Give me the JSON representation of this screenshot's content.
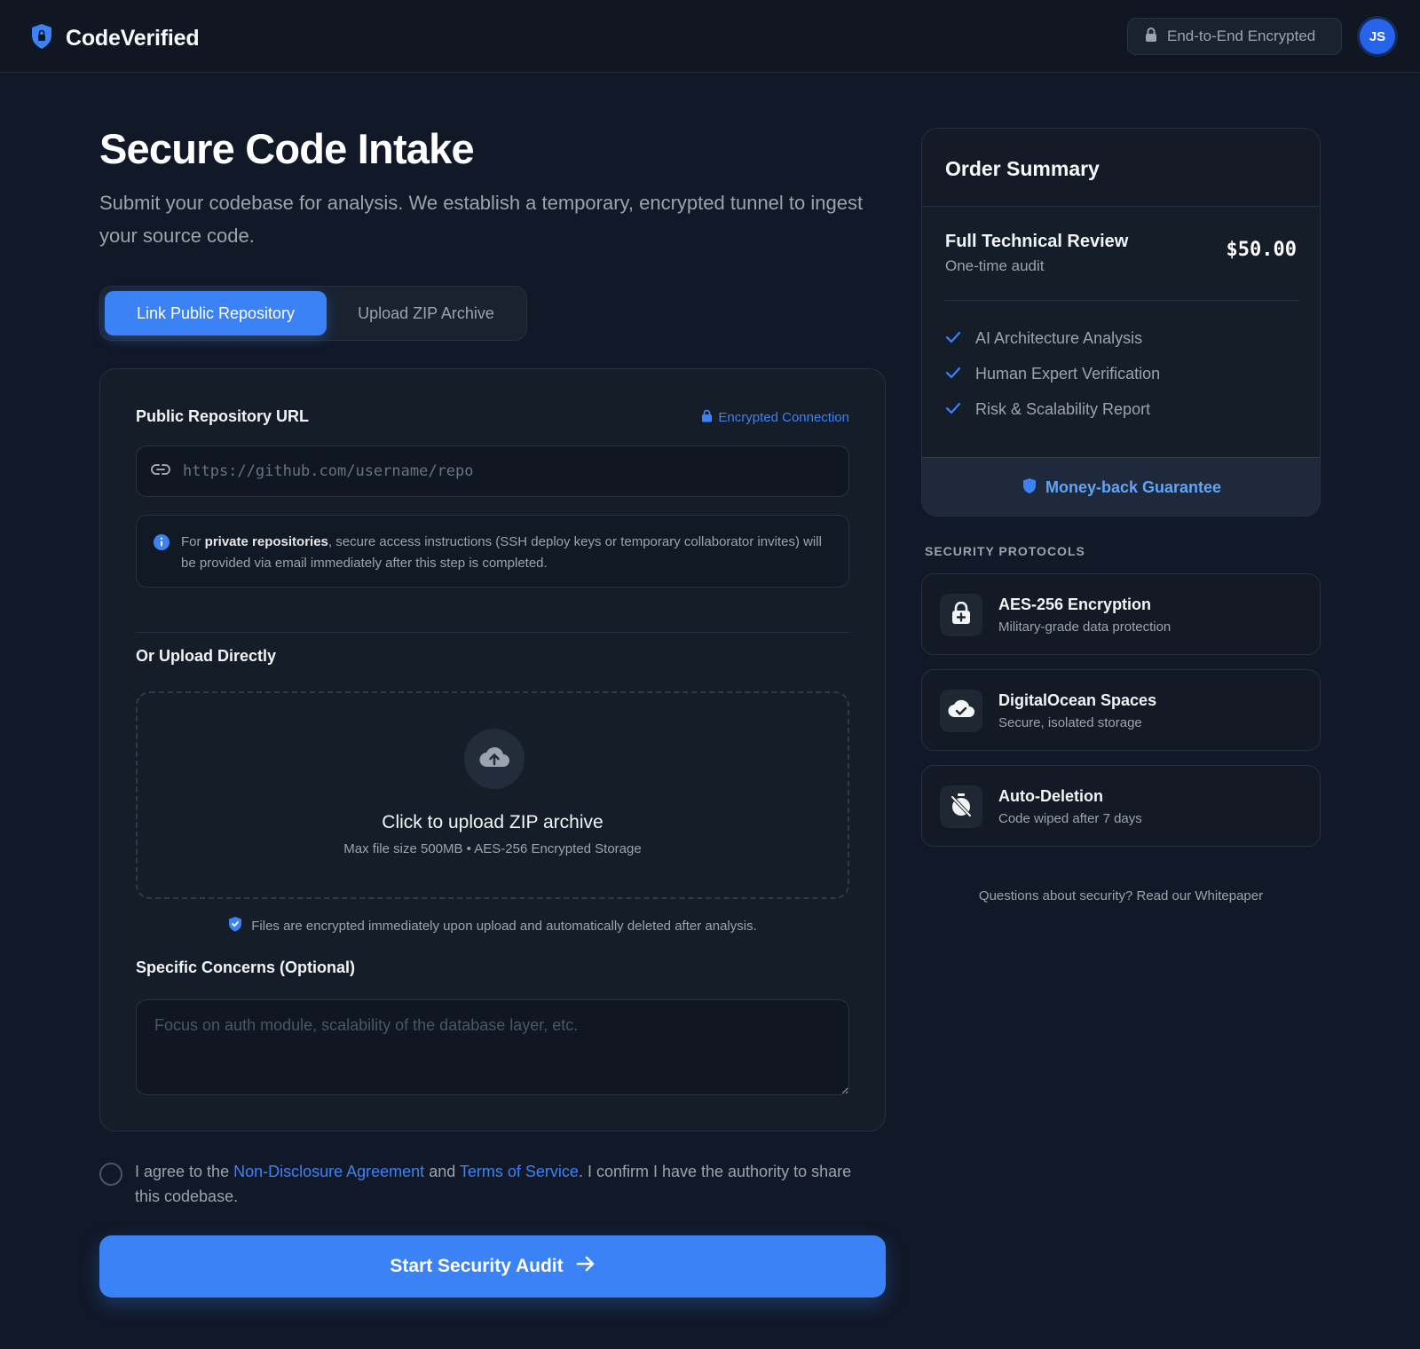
{
  "brand": {
    "name": "CodeVerified",
    "icon": "shield-lock-icon",
    "accent": "#3b82f6"
  },
  "header": {
    "encryption_badge": "End-to-End Encrypted",
    "avatar_initials": "JS"
  },
  "main": {
    "title": "Secure Code Intake",
    "subtitle": "Submit your codebase for analysis. We establish a temporary, encrypted tunnel to ingest your source code.",
    "tabs": [
      {
        "label": "Link Public Repository",
        "active": true
      },
      {
        "label": "Upload ZIP Archive",
        "active": false
      }
    ],
    "repo": {
      "label": "Public Repository URL",
      "encrypted_label": "Encrypted Connection",
      "placeholder": "https://github.com/username/repo",
      "info_prefix": "For ",
      "info_bold": "private repositories",
      "info_rest": ", secure access instructions (SSH deploy keys or temporary collaborator invites) will be provided via email immediately after this step is completed."
    },
    "upload": {
      "label": "Or Upload Directly",
      "title": "Click to upload ZIP archive",
      "subtitle": "Max file size 500MB • AES-256 Encrypted Storage",
      "note": "Files are encrypted immediately upon upload and automatically deleted after analysis."
    },
    "concerns": {
      "label": "Specific Concerns (Optional)",
      "placeholder": "Focus on auth module, scalability of the database layer, etc."
    },
    "agreement": {
      "prefix": "I agree to the ",
      "nda_link": "Non-Disclosure Agreement",
      "middle": " and ",
      "tos_link": "Terms of Service",
      "suffix": ". I confirm I have the authority to share this codebase."
    },
    "cta_label": "Start Security Audit"
  },
  "order": {
    "title": "Order Summary",
    "item_name": "Full Technical Review",
    "item_sub": "One-time audit",
    "price": "$50.00",
    "features": [
      "AI Architecture Analysis",
      "Human Expert Verification",
      "Risk & Scalability Report"
    ],
    "guarantee": "Money-back Guarantee"
  },
  "security": {
    "title": "SECURITY PROTOCOLS",
    "protocols": [
      {
        "title": "AES-256 Encryption",
        "subtitle": "Military-grade data protection",
        "icon": "lock-plus-icon"
      },
      {
        "title": "DigitalOcean Spaces",
        "subtitle": "Secure, isolated storage",
        "icon": "cloud-check-icon"
      },
      {
        "title": "Auto-Deletion",
        "subtitle": "Code wiped after 7 days",
        "icon": "timer-off-icon"
      }
    ],
    "footer": "Questions about security? Read our Whitepaper"
  }
}
